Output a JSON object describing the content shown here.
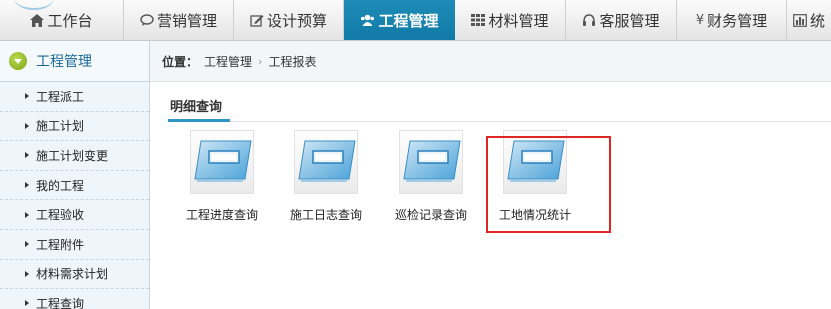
{
  "nav": {
    "tabs": [
      {
        "label": "工作台",
        "icon": "home-icon"
      },
      {
        "label": "营销管理",
        "icon": "chat-icon"
      },
      {
        "label": "设计预算",
        "icon": "edit-icon"
      },
      {
        "label": "工程管理",
        "icon": "users-icon",
        "active": true
      },
      {
        "label": "材料管理",
        "icon": "grid-icon"
      },
      {
        "label": "客服管理",
        "icon": "headset-icon"
      },
      {
        "label": "财务管理",
        "icon": "yen-icon"
      },
      {
        "label": "统",
        "icon": "chart-icon"
      }
    ],
    "accent": "#1789b5"
  },
  "sidebar": {
    "title": "工程管理",
    "items": [
      {
        "label": "工程派工"
      },
      {
        "label": "施工计划"
      },
      {
        "label": "施工计划变更"
      },
      {
        "label": "我的工程"
      },
      {
        "label": "工程验收"
      },
      {
        "label": "工程附件"
      },
      {
        "label": "材料需求计划"
      },
      {
        "label": "工程查询"
      }
    ]
  },
  "breadcrumb": {
    "label": "位置：",
    "items": [
      "工程管理",
      "工程报表"
    ],
    "separator": "›"
  },
  "content": {
    "subtab": "明细查询",
    "tiles": [
      {
        "label": "工程进度查询"
      },
      {
        "label": "施工日志查询"
      },
      {
        "label": "巡检记录查询"
      },
      {
        "label": "工地情况统计"
      }
    ],
    "highlight_color": "#e02525"
  }
}
